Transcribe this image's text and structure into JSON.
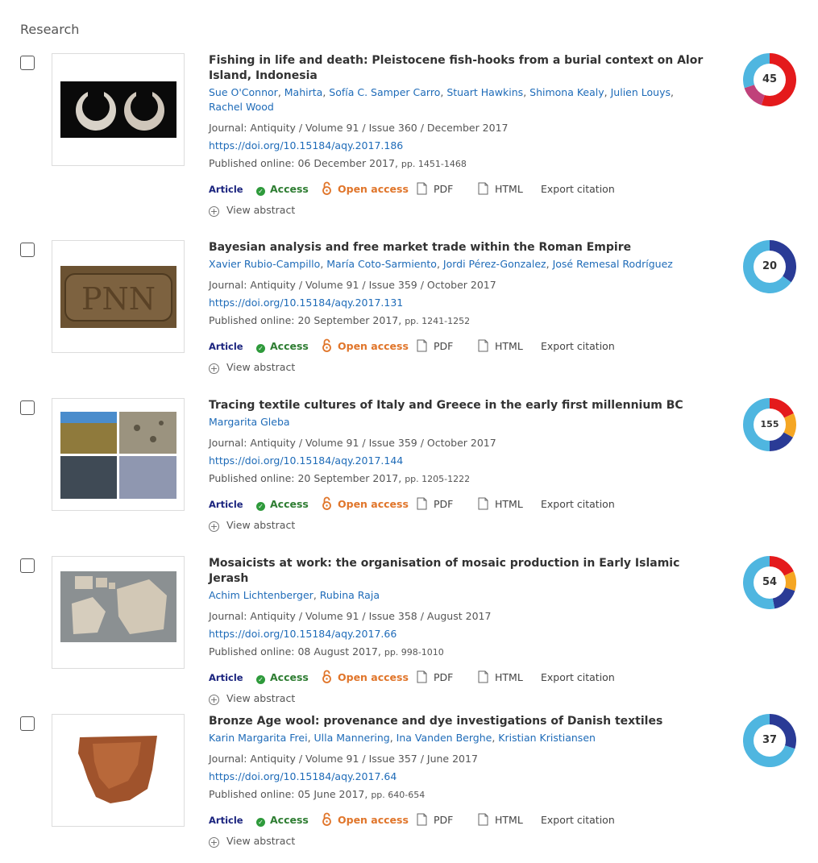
{
  "section": {
    "title": "Research"
  },
  "labels": {
    "type": "Article",
    "access": "Access",
    "open_access": "Open access",
    "pdf": "PDF",
    "html": "HTML",
    "export": "Export citation",
    "view_abstract": "View abstract"
  },
  "colors": {
    "link": "#1e6bb8",
    "article_label": "#1a237e",
    "access": "#2e7d32",
    "open_access": "#e0752a"
  },
  "articles": [
    {
      "title": "Fishing in life and death: Pleistocene fish-hooks from a burial context on Alor Island, Indonesia",
      "authors": [
        "Sue O'Connor",
        "Mahirta",
        "Sofía C. Samper Carro",
        "Stuart Hawkins",
        "Shimona Kealy",
        "Julien Louys",
        "Rachel Wood"
      ],
      "journal": "Journal: Antiquity / Volume 91 / Issue 360 / December 2017",
      "doi": "https://doi.org/10.15184/aqy.2017.186",
      "published": "Published online: 06 December 2017,",
      "pages": "pp. 1451-1468",
      "altmetric": "45",
      "thumbnail": "two-shell-fishhooks"
    },
    {
      "title": "Bayesian analysis and free market trade within the Roman Empire",
      "authors": [
        "Xavier Rubio-Campillo",
        "María Coto-Sarmiento",
        "Jordi Pérez-Gonzalez",
        "José Remesal Rodríguez"
      ],
      "journal": "Journal: Antiquity / Volume 91 / Issue 359 / October 2017",
      "doi": "https://doi.org/10.15184/aqy.2017.131",
      "published": "Published online: 20 September 2017,",
      "pages": "pp. 1241-1252",
      "altmetric": "20",
      "thumbnail": "stamped-amphora"
    },
    {
      "title": "Tracing textile cultures of Italy and Greece in the early first millennium BC",
      "authors": [
        "Margarita Gleba"
      ],
      "journal": "Journal: Antiquity / Volume 91 / Issue 359 / October 2017",
      "doi": "https://doi.org/10.15184/aqy.2017.144",
      "published": "Published online: 20 September 2017,",
      "pages": "pp. 1205-1222",
      "altmetric": "155",
      "thumbnail": "textile-fragments-grid"
    },
    {
      "title": "Mosaicists at work: the organisation of mosaic production in Early Islamic Jerash",
      "authors": [
        "Achim Lichtenberger",
        "Rubina Raja"
      ],
      "journal": "Journal: Antiquity / Volume 91 / Issue 358 / August 2017",
      "doi": "https://doi.org/10.15184/aqy.2017.66",
      "published": "Published online: 08 August 2017,",
      "pages": "pp. 998-1010",
      "altmetric": "54",
      "thumbnail": "mosaic-tesserae"
    },
    {
      "title": "Bronze Age wool: provenance and dye investigations of Danish textiles",
      "authors": [
        "Karin Margarita Frei",
        "Ulla Mannering",
        "Ina Vanden Berghe",
        "Kristian Kristiansen"
      ],
      "journal": "Journal: Antiquity / Volume 91 / Issue 357 / June 2017",
      "doi": "https://doi.org/10.15184/aqy.2017.64",
      "published": "Published online: 05 June 2017,",
      "pages": "pp. 640-654",
      "altmetric": "37",
      "thumbnail": "wool-textile"
    }
  ]
}
